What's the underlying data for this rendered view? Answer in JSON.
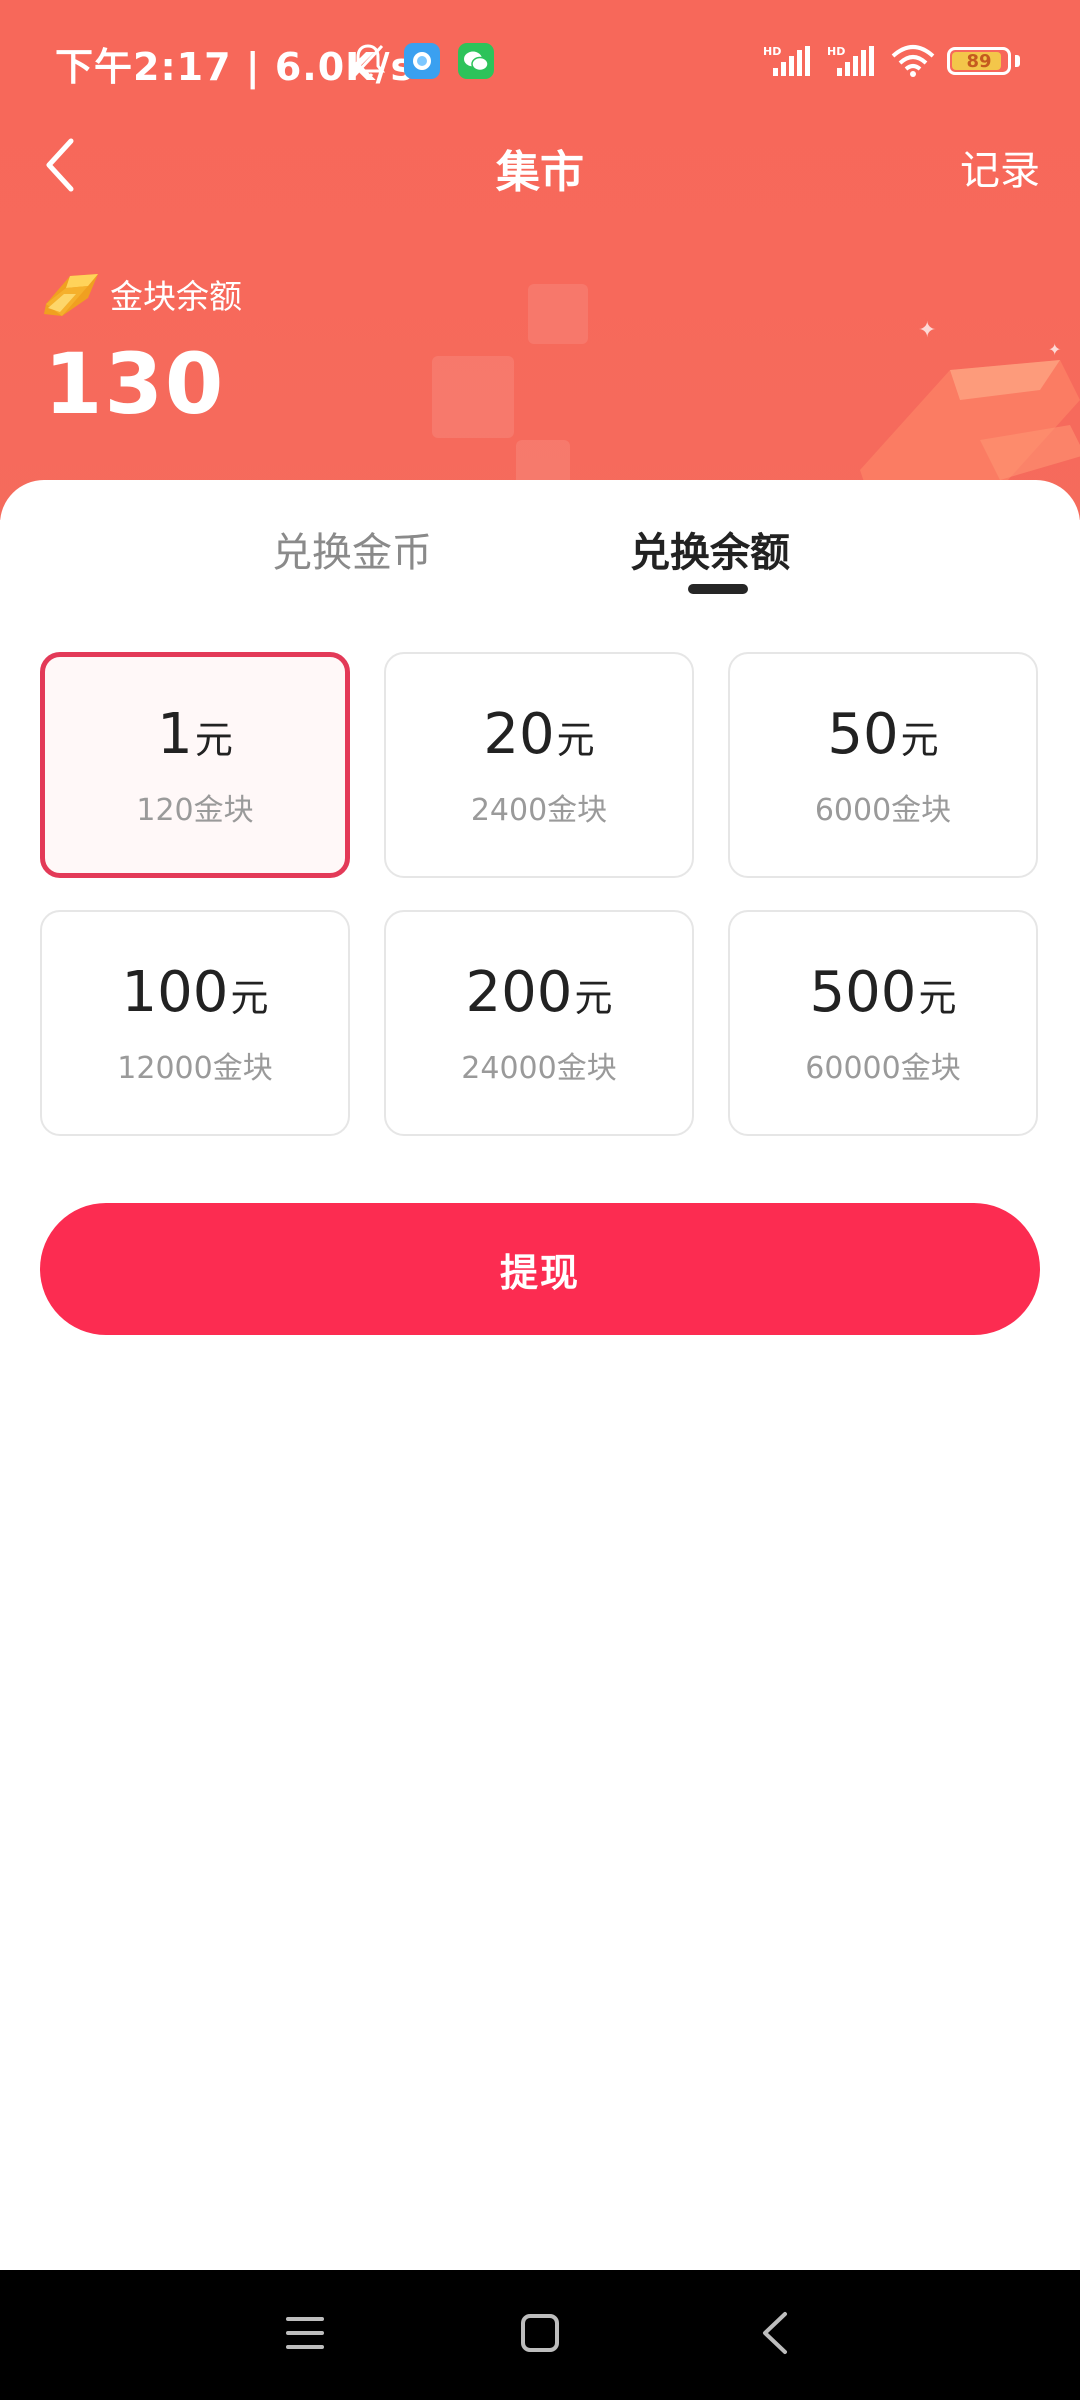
{
  "status_bar": {
    "time_speed": "下午2:17 | 6.0K/s",
    "battery_level": "89",
    "accent_battery_color": "#f3c64a"
  },
  "nav": {
    "back_icon": "chevron-left-icon",
    "title": "集市",
    "record_label": "记录"
  },
  "balance": {
    "label": "金块余额",
    "value": "130",
    "icon": "gold-bar-icon"
  },
  "tabs": [
    {
      "label": "兑换金币",
      "active": false
    },
    {
      "label": "兑换余额",
      "active": true
    }
  ],
  "options": [
    {
      "amount": "1",
      "unit": "元",
      "cost": "120金块",
      "selected": true
    },
    {
      "amount": "20",
      "unit": "元",
      "cost": "2400金块",
      "selected": false
    },
    {
      "amount": "50",
      "unit": "元",
      "cost": "6000金块",
      "selected": false
    },
    {
      "amount": "100",
      "unit": "元",
      "cost": "12000金块",
      "selected": false
    },
    {
      "amount": "200",
      "unit": "元",
      "cost": "24000金块",
      "selected": false
    },
    {
      "amount": "500",
      "unit": "元",
      "cost": "60000金块",
      "selected": false
    }
  ],
  "withdraw_label": "提现",
  "colors": {
    "header_bg": "#f7685a",
    "primary_button": "#fc2c51",
    "selected_border": "#e33a58"
  },
  "system_nav": {
    "menu_icon": "menu-icon",
    "home_icon": "home-square-icon",
    "back_icon": "back-triangle-icon"
  }
}
